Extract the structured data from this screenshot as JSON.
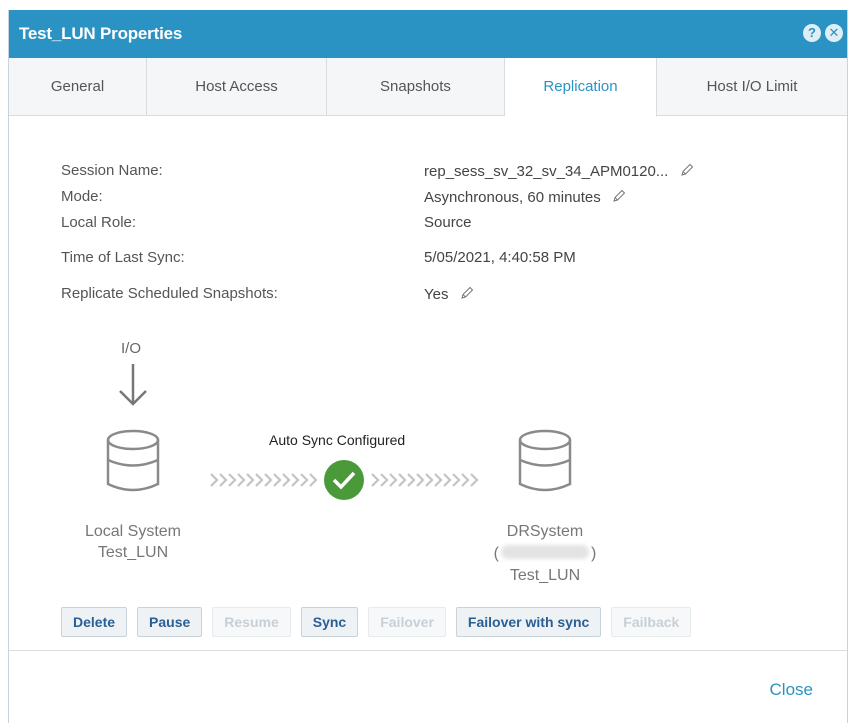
{
  "dialog": {
    "title": "Test_LUN Properties",
    "help_icon": "help-icon",
    "close_icon": "close-icon"
  },
  "tabs": [
    {
      "label": "General",
      "active": false
    },
    {
      "label": "Host Access",
      "active": false
    },
    {
      "label": "Snapshots",
      "active": false
    },
    {
      "label": "Replication",
      "active": true
    },
    {
      "label": "Host I/O Limit",
      "active": false
    }
  ],
  "properties": {
    "session_name": {
      "label": "Session Name:",
      "value": "rep_sess_sv_32_sv_34_APM0120..."
    },
    "mode": {
      "label": "Mode:",
      "value": "Asynchronous, 60 minutes"
    },
    "local_role": {
      "label": "Local Role:",
      "value": "Source"
    },
    "last_sync": {
      "label": "Time of Last Sync:",
      "value": "5/05/2021, 4:40:58 PM"
    },
    "replicate_snapshots": {
      "label": "Replicate Scheduled Snapshots:",
      "value": "Yes"
    }
  },
  "diagram": {
    "io_label": "I/O",
    "sync_status": "Auto Sync Configured",
    "local": {
      "system": "Local System",
      "lun": "Test_LUN"
    },
    "remote": {
      "system": "DRSystem",
      "open_paren": "(",
      "close_paren": ")",
      "lun": "Test_LUN"
    },
    "colors": {
      "check": "#4a9a3a",
      "chevron": "#c4c4c4",
      "db": "#8a8a8a"
    }
  },
  "buttons": {
    "delete": "Delete",
    "pause": "Pause",
    "resume": "Resume",
    "sync": "Sync",
    "failover": "Failover",
    "failover_sync": "Failover with sync",
    "failback": "Failback"
  },
  "footer": {
    "close": "Close"
  },
  "colors": {
    "accent": "#2a93c4"
  }
}
